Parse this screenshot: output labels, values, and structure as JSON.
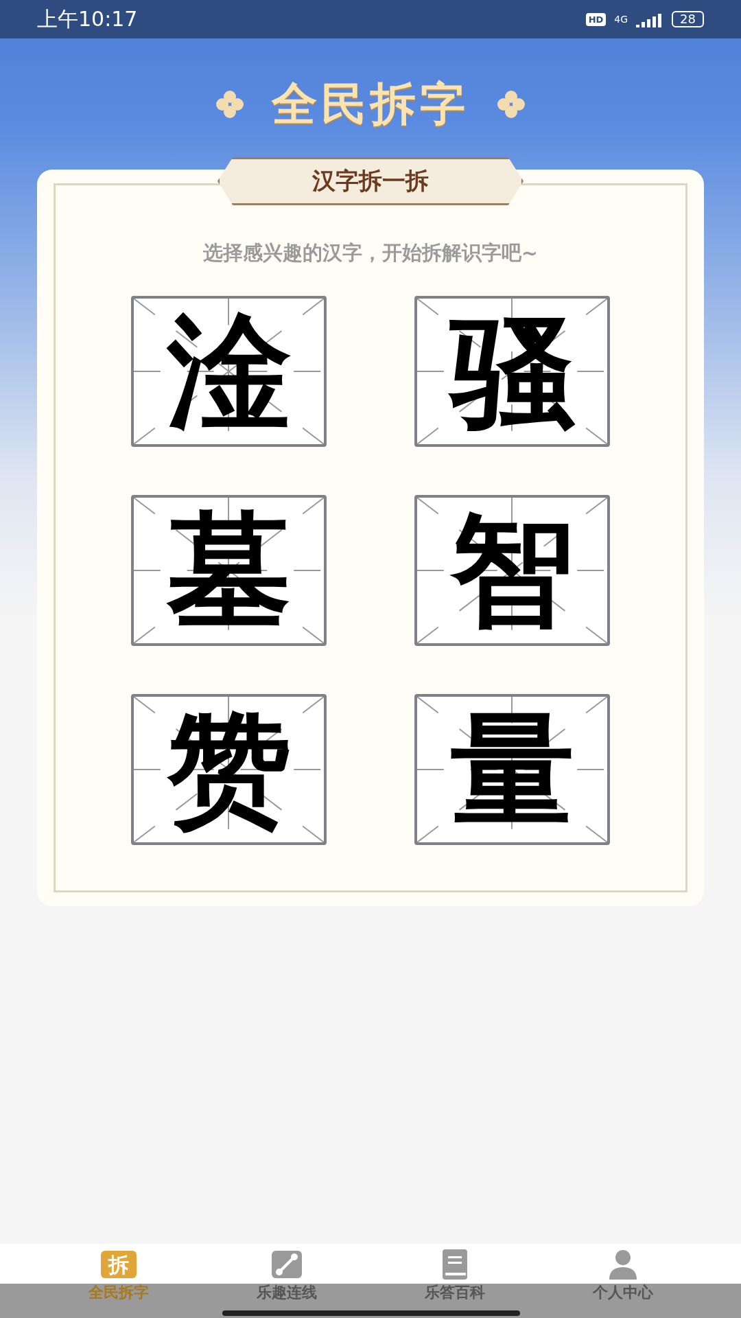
{
  "status_bar": {
    "time": "上午10:17",
    "hd": "HD",
    "network": "4G",
    "battery": "28"
  },
  "title": "全民拆字",
  "card": {
    "tab_label": "汉字拆一拆",
    "subtitle": "选择感兴趣的汉字，开始拆解识字吧~",
    "characters": [
      "淦",
      "骚",
      "墓",
      "智",
      "赞",
      "量"
    ]
  },
  "nav": [
    {
      "label": "全民拆字",
      "icon_text": "拆",
      "kind": "glyph",
      "selected": true
    },
    {
      "label": "乐趣连线",
      "kind": "link",
      "selected": false
    },
    {
      "label": "乐答百科",
      "kind": "book",
      "selected": false
    },
    {
      "label": "个人中心",
      "kind": "person",
      "selected": false
    }
  ]
}
